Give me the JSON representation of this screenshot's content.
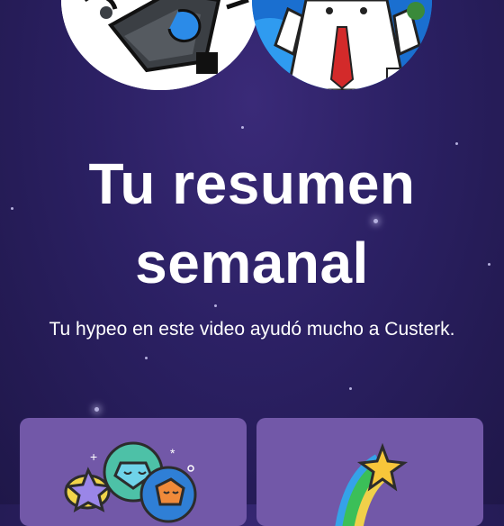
{
  "summary": {
    "title_line1": "Tu resumen",
    "title_line2": "semanal",
    "message": "Tu hypeo en este video ayudó mucho a Custerk."
  },
  "avatars": [
    {
      "name": "robot-avatar-icon"
    },
    {
      "name": "thumbs-up-character-icon"
    }
  ],
  "cards": [
    {
      "icon": "gem-friends-icon"
    },
    {
      "icon": "shooting-star-icon"
    }
  ],
  "colors": {
    "background_top": "#3a2a78",
    "background_bottom": "#1f1749",
    "card": "#7258a8",
    "text": "#ffffff"
  }
}
